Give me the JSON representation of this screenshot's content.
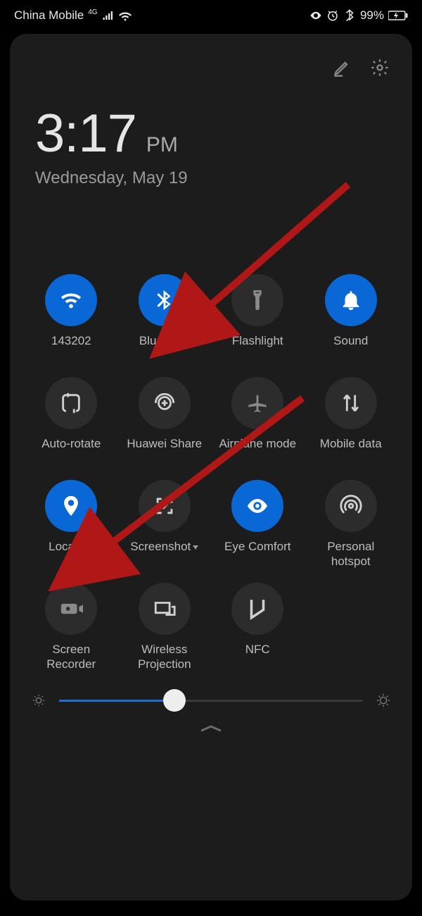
{
  "statusbar": {
    "carrier": "China Mobile",
    "network_badge": "4G",
    "battery_text": "99%"
  },
  "panel": {
    "time": "3:17",
    "ampm": "PM",
    "date": "Wednesday, May 19"
  },
  "tiles": [
    {
      "id": "wifi",
      "label": "143202",
      "on": true,
      "icon": "wifi"
    },
    {
      "id": "bluetooth",
      "label": "Bluetooth",
      "on": true,
      "icon": "bluetooth"
    },
    {
      "id": "flashlight",
      "label": "Flashlight",
      "on": false,
      "icon": "flashlight"
    },
    {
      "id": "sound",
      "label": "Sound",
      "on": true,
      "icon": "bell"
    },
    {
      "id": "autorotate",
      "label": "Auto-rotate",
      "on": false,
      "icon": "rotate"
    },
    {
      "id": "huaweishare",
      "label": "Huawei Share",
      "on": false,
      "icon": "share"
    },
    {
      "id": "airplane",
      "label": "Airplane mode",
      "on": false,
      "icon": "airplane"
    },
    {
      "id": "mobiledata",
      "label": "Mobile data",
      "on": false,
      "icon": "data"
    },
    {
      "id": "location",
      "label": "Location",
      "on": true,
      "icon": "location"
    },
    {
      "id": "screenshot",
      "label": "Screenshot",
      "on": false,
      "icon": "screenshot",
      "dropdown": true
    },
    {
      "id": "eyecomfort",
      "label": "Eye Comfort",
      "on": true,
      "icon": "eye"
    },
    {
      "id": "hotspot",
      "label": "Personal hotspot",
      "on": false,
      "icon": "hotspot"
    },
    {
      "id": "recorder",
      "label": "Screen Recorder",
      "on": false,
      "icon": "recorder"
    },
    {
      "id": "projection",
      "label": "Wireless Projection",
      "on": false,
      "icon": "projection"
    },
    {
      "id": "nfc",
      "label": "NFC",
      "on": false,
      "icon": "nfc"
    }
  ],
  "brightness": {
    "value": 38,
    "min": 0,
    "max": 100
  },
  "colors": {
    "accent": "#0967d6",
    "panel": "#1c1c1c",
    "tile_off": "#2c2c2c",
    "arrow": "#b01818"
  },
  "annotations": {
    "arrow1_target": "bluetooth",
    "arrow2_target": "location"
  }
}
